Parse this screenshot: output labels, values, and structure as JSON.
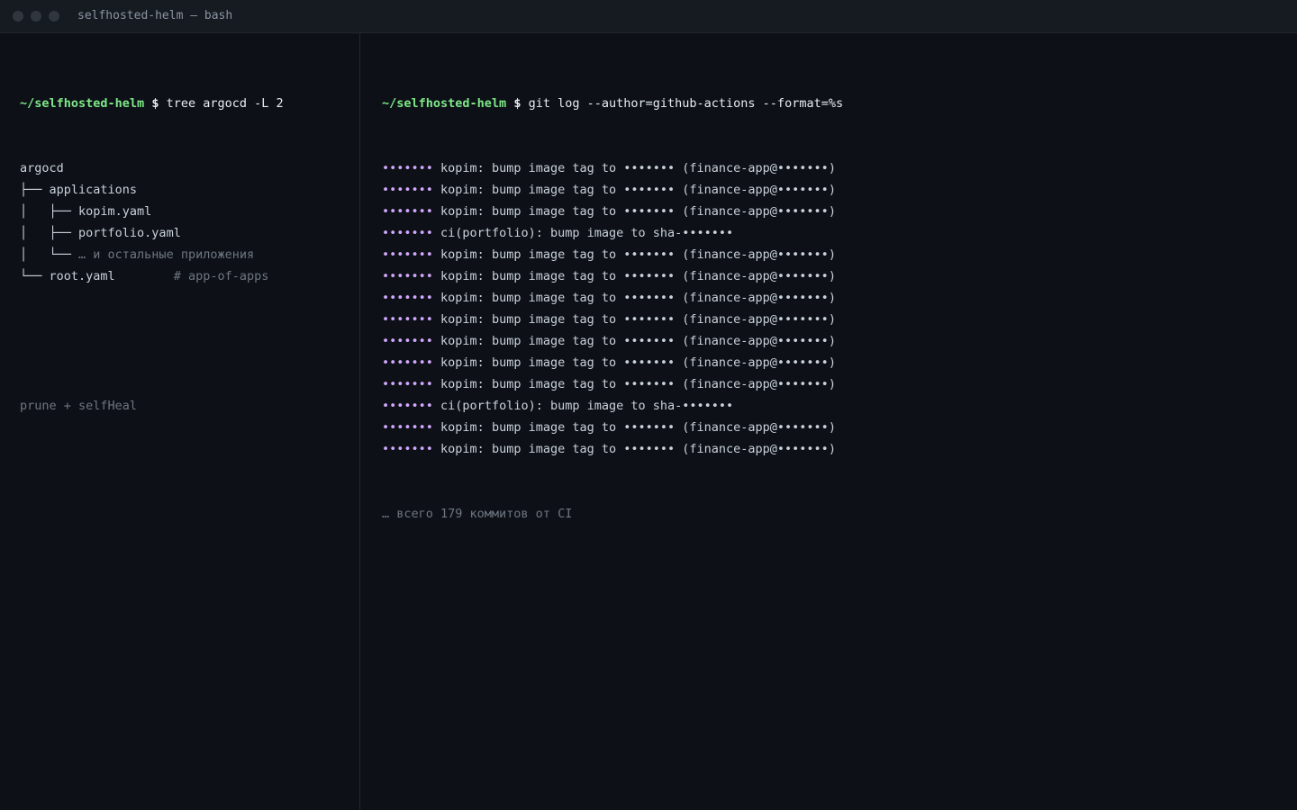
{
  "window": {
    "title": "selfhosted-helm — bash"
  },
  "left_pane": {
    "prompt_path": "~/selfhosted-helm",
    "prompt_sign": "$",
    "command": "tree argocd -L 2",
    "tree": [
      {
        "prefix": "",
        "name": "argocd",
        "comment": ""
      },
      {
        "prefix": "├── ",
        "name": "applications",
        "comment": ""
      },
      {
        "prefix": "│   ├── ",
        "name": "kopim.yaml",
        "comment": ""
      },
      {
        "prefix": "│   ├── ",
        "name": "portfolio.yaml",
        "comment": ""
      },
      {
        "prefix": "│   └── ",
        "name": "",
        "comment": "… и остальные приложения"
      },
      {
        "prefix": "└── ",
        "name": "root.yaml",
        "comment": "# app-of-apps"
      }
    ],
    "footer_note": "prune + selfHeal"
  },
  "right_pane": {
    "prompt_path": "~/selfhosted-helm",
    "prompt_sign": "$",
    "command": "git log --author=github-actions --format=%s",
    "commits": [
      {
        "hash": "•••••••",
        "message": "kopim: bump image tag to ••••••• (finance-app@•••••••)"
      },
      {
        "hash": "•••••••",
        "message": "kopim: bump image tag to ••••••• (finance-app@•••••••)"
      },
      {
        "hash": "•••••••",
        "message": "kopim: bump image tag to ••••••• (finance-app@•••••••)"
      },
      {
        "hash": "•••••••",
        "message": "ci(portfolio): bump image to sha-•••••••"
      },
      {
        "hash": "•••••••",
        "message": "kopim: bump image tag to ••••••• (finance-app@•••••••)"
      },
      {
        "hash": "•••••••",
        "message": "kopim: bump image tag to ••••••• (finance-app@•••••••)"
      },
      {
        "hash": "•••••••",
        "message": "kopim: bump image tag to ••••••• (finance-app@•••••••)"
      },
      {
        "hash": "•••••••",
        "message": "kopim: bump image tag to ••••••• (finance-app@•••••••)"
      },
      {
        "hash": "•••••••",
        "message": "kopim: bump image tag to ••••••• (finance-app@•••••••)"
      },
      {
        "hash": "•••••••",
        "message": "kopim: bump image tag to ••••••• (finance-app@•••••••)"
      },
      {
        "hash": "•••••••",
        "message": "kopim: bump image tag to ••••••• (finance-app@•••••••)"
      },
      {
        "hash": "•••••••",
        "message": "ci(portfolio): bump image to sha-•••••••"
      },
      {
        "hash": "•••••••",
        "message": "kopim: bump image tag to ••••••• (finance-app@•••••••)"
      },
      {
        "hash": "•••••••",
        "message": "kopim: bump image tag to ••••••• (finance-app@•••••••)"
      }
    ],
    "summary": "… всего 179 коммитов от CI"
  }
}
